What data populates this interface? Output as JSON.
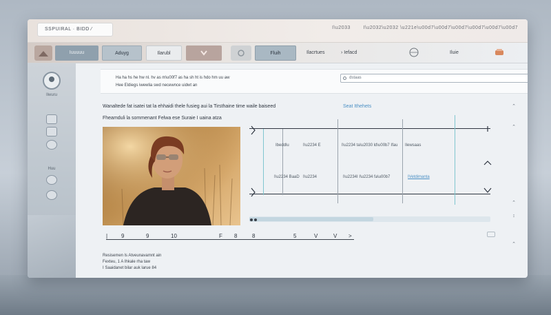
{
  "window": {
    "title": "SSPUIRAL · BIDD ⁄",
    "title_right": [
      "I\\u2033",
      "I\\u2032\\u2032 \\u221e\\u00d7\\u00d7\\u00d7\\u00d7\\u00d7\\u00d7"
    ]
  },
  "toolbar": {
    "btn1": "Iuuuuu",
    "btn2": "Aduyg",
    "btn3": "Ilarubl",
    "btn4": "Fluih",
    "txt1": "Ilacrtues",
    "txt2": "Iefacd",
    "txt3": "Iluie"
  },
  "sidebar": {
    "profile_label": "Ilwuru",
    "section_label": "Huu"
  },
  "url_panel": {
    "line1": "Ha ha hs he hw nl. hv as m\\u00f7 as ha sh ht is hdo hm uu aw",
    "line2": "Hee Eldiegs iwewlia swd necewnce uidwt an",
    "search_placeholder": "dstaas"
  },
  "content": {
    "desc1": "Wanaltede fat isatei tat la ehhaidi thele fusieg aui la Tirsthaine time waile baiseed",
    "desc2": "Fheamduli la sommenant Felwa ese Suraie I uaina atza",
    "link": "Seat Ithehets"
  },
  "table": {
    "r1c1": "Ibeddlu",
    "r1c2": "I\\u2234 E",
    "r1c3": "I\\u2234 ta\\u2030 ld\\u00b7 Ifau",
    "r1c4": "Ilewsaas",
    "r2c1": "I\\u2234 BaaD",
    "r2c2": "I\\u2234",
    "r2c3": "I\\u2234I I\\u2234 fa\\u00b7",
    "r2c4": "IVetdimanta"
  },
  "ruler": [
    "9",
    "9",
    "10",
    "F",
    "8",
    "8",
    "5",
    "V",
    "V",
    ">"
  ],
  "footer": {
    "line1": "Resisemen ls Atveunavamnt ain",
    "line2": "Fexteu, 1 A Ihkale rha taw",
    "line3": "I Saaidanet bilar auk larue 84"
  },
  "colors": {
    "accent": "#4a8fc4",
    "sidebar": "#c4ccd4",
    "toolbar_active": "#8fa0ad"
  }
}
